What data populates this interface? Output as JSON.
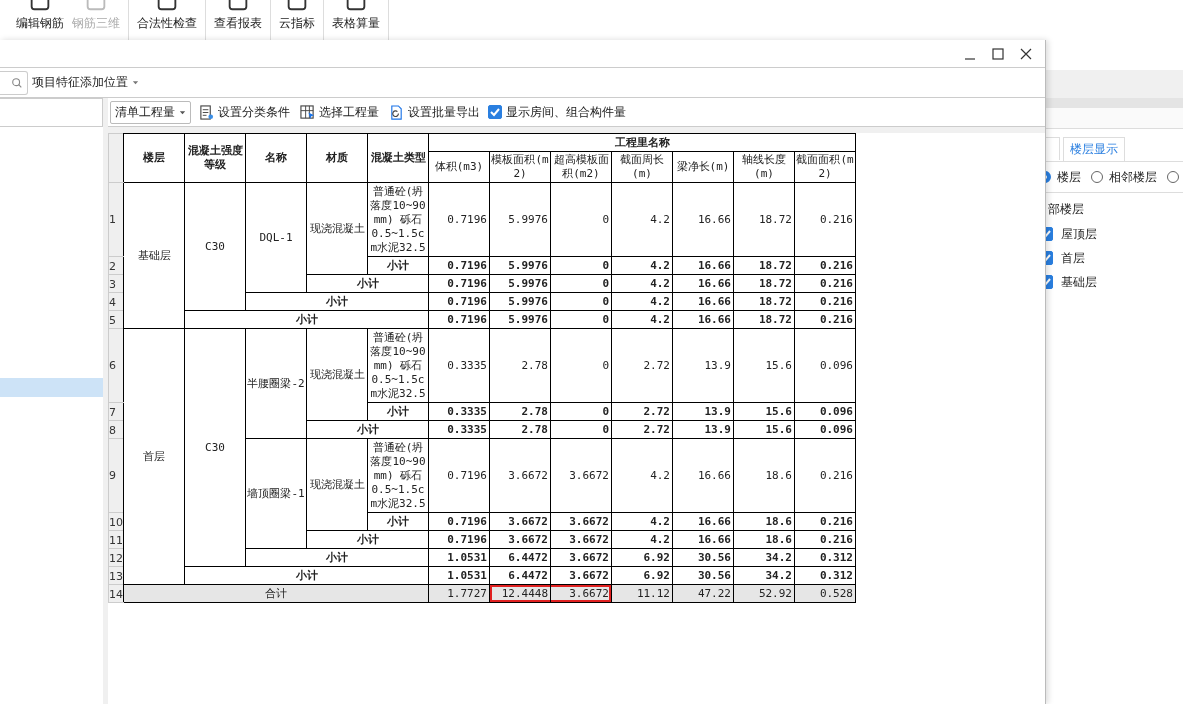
{
  "app_toolbar": {
    "groups": [
      [
        {
          "label": "编辑钢筋",
          "disabled": false
        },
        {
          "label": "钢筋三维",
          "disabled": true
        }
      ],
      [
        {
          "label": "合法性检查",
          "disabled": false
        }
      ],
      [
        {
          "label": "查看报表",
          "disabled": false
        }
      ],
      [
        {
          "label": "云指标",
          "disabled": false
        }
      ],
      [
        {
          "label": "表格算量",
          "disabled": false
        }
      ]
    ]
  },
  "side_panel": {
    "tabs": [
      {
        "label": "楼层显示",
        "selected": true
      }
    ],
    "radios": [
      {
        "label": "楼层",
        "selected": true
      },
      {
        "label": "相邻楼层",
        "selected": false
      }
    ],
    "group_label": "部楼层",
    "floors": [
      {
        "label": "屋顶层",
        "checked": true
      },
      {
        "label": "首层",
        "checked": true
      },
      {
        "label": "基础层",
        "checked": true
      }
    ]
  },
  "dialog": {
    "position_dropdown": "项目特征添加位置",
    "toolbar": {
      "quantity_select": "清单工程量",
      "buttons": [
        "设置分类条件",
        "选择工程量",
        "设置批量导出"
      ],
      "show_rooms": {
        "label": "显示房间、组合构件量",
        "checked": true
      }
    },
    "table": {
      "columns": [
        "楼层",
        "混凝土强度等级",
        "名称",
        "材质",
        "混凝土类型"
      ],
      "group_header": "工程里名称",
      "quantity_columns": [
        "体积(m3)",
        "模板面积(m2)",
        "超高模板面积(m2)",
        "截面周长(m)",
        "梁净长(m)",
        "轴线长度(m)",
        "截面面积(m2)"
      ],
      "rows": [
        {
          "number": "1",
          "kind": "detail",
          "cells": [
            {
              "text": "基础层",
              "rowspan": 5
            },
            {
              "text": "C30",
              "rowspan": 4
            },
            {
              "text": "DQL-1",
              "rowspan": 3
            },
            {
              "text": "现浇混凝土",
              "rowspan": 2
            },
            {
              "text": "普通砼(坍落度10~90mm) 砾石0.5~1.5cm水泥32.5"
            }
          ],
          "values": [
            "0.7196",
            "5.9976",
            "0",
            "4.2",
            "16.66",
            "18.72",
            "0.216"
          ]
        },
        {
          "number": "2",
          "kind": "subtotal",
          "cells": [
            {
              "text": "小计"
            }
          ],
          "values": [
            "0.7196",
            "5.9976",
            "0",
            "4.2",
            "16.66",
            "18.72",
            "0.216"
          ]
        },
        {
          "number": "3",
          "kind": "subtotal",
          "cells": [
            {
              "text": "小计",
              "colspan": 2
            }
          ],
          "values": [
            "0.7196",
            "5.9976",
            "0",
            "4.2",
            "16.66",
            "18.72",
            "0.216"
          ]
        },
        {
          "number": "4",
          "kind": "subtotal",
          "cells": [
            {
              "text": "小计",
              "colspan": 3
            }
          ],
          "values": [
            "0.7196",
            "5.9976",
            "0",
            "4.2",
            "16.66",
            "18.72",
            "0.216"
          ]
        },
        {
          "number": "5",
          "kind": "subtotal",
          "cells": [
            {
              "text": "小计",
              "colspan": 4
            }
          ],
          "values": [
            "0.7196",
            "5.9976",
            "0",
            "4.2",
            "16.66",
            "18.72",
            "0.216"
          ]
        },
        {
          "number": "6",
          "kind": "detail",
          "cells": [
            {
              "text": "首层",
              "rowspan": 8
            },
            {
              "text": "C30",
              "rowspan": 7
            },
            {
              "text": "半腰圈梁-2",
              "rowspan": 3
            },
            {
              "text": "现浇混凝土",
              "rowspan": 2
            },
            {
              "text": "普通砼(坍落度10~90mm) 砾石0.5~1.5cm水泥32.5"
            }
          ],
          "values": [
            "0.3335",
            "2.78",
            "0",
            "2.72",
            "13.9",
            "15.6",
            "0.096"
          ]
        },
        {
          "number": "7",
          "kind": "subtotal",
          "cells": [
            {
              "text": "小计"
            }
          ],
          "values": [
            "0.3335",
            "2.78",
            "0",
            "2.72",
            "13.9",
            "15.6",
            "0.096"
          ]
        },
        {
          "number": "8",
          "kind": "subtotal",
          "cells": [
            {
              "text": "小计",
              "colspan": 2
            }
          ],
          "values": [
            "0.3335",
            "2.78",
            "0",
            "2.72",
            "13.9",
            "15.6",
            "0.096"
          ]
        },
        {
          "number": "9",
          "kind": "detail",
          "cells": [
            {
              "text": "墙顶圈梁-1",
              "rowspan": 3
            },
            {
              "text": "现浇混凝土",
              "rowspan": 2
            },
            {
              "text": "普通砼(坍落度10~90mm) 砾石0.5~1.5cm水泥32.5"
            }
          ],
          "values": [
            "0.7196",
            "3.6672",
            "3.6672",
            "4.2",
            "16.66",
            "18.6",
            "0.216"
          ]
        },
        {
          "number": "10",
          "kind": "subtotal",
          "cells": [
            {
              "text": "小计"
            }
          ],
          "values": [
            "0.7196",
            "3.6672",
            "3.6672",
            "4.2",
            "16.66",
            "18.6",
            "0.216"
          ]
        },
        {
          "number": "11",
          "kind": "subtotal",
          "cells": [
            {
              "text": "小计",
              "colspan": 2
            }
          ],
          "values": [
            "0.7196",
            "3.6672",
            "3.6672",
            "4.2",
            "16.66",
            "18.6",
            "0.216"
          ]
        },
        {
          "number": "12",
          "kind": "subtotal",
          "cells": [
            {
              "text": "小计",
              "colspan": 3
            }
          ],
          "values": [
            "1.0531",
            "6.4472",
            "3.6672",
            "6.92",
            "30.56",
            "34.2",
            "0.312"
          ]
        },
        {
          "number": "13",
          "kind": "subtotal",
          "cells": [
            {
              "text": "小计",
              "colspan": 4
            }
          ],
          "values": [
            "1.0531",
            "6.4472",
            "3.6672",
            "6.92",
            "30.56",
            "34.2",
            "0.312"
          ]
        },
        {
          "number": "14",
          "kind": "total",
          "cells": [
            {
              "text": "合计",
              "colspan": 5
            }
          ],
          "values": [
            "1.7727",
            "12.4448",
            "3.6672",
            "11.12",
            "47.22",
            "52.92",
            "0.528"
          ],
          "marked": [
            false,
            true,
            true,
            false,
            false,
            false,
            false
          ]
        }
      ]
    }
  }
}
